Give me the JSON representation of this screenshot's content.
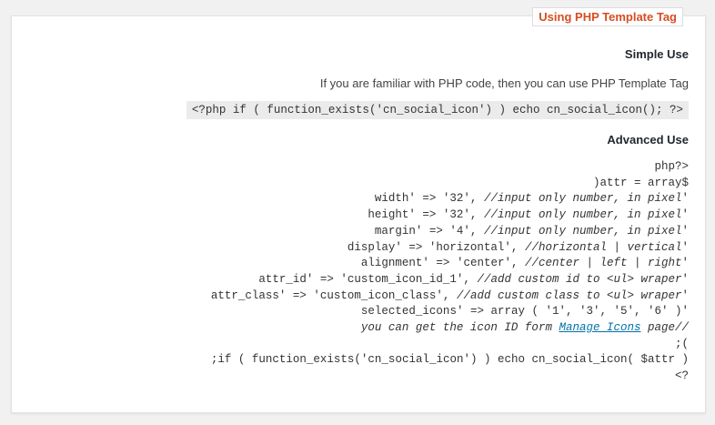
{
  "panel": {
    "title": "Using PHP Template Tag"
  },
  "simple": {
    "heading": "Simple Use",
    "description": "If you are familiar with PHP code, then you can use PHP Template Tag",
    "code": "<?php if ( function_exists('cn_social_icon') ) echo cn_social_icon(); ?>"
  },
  "advanced": {
    "heading": "Advanced Use",
    "lines": [
      {
        "code": "<?php"
      },
      {
        "code": "$attr = array("
      },
      {
        "code": "'width' => '32', ",
        "comment": "//input only number, in pixel"
      },
      {
        "code": "'height' => '32', ",
        "comment": "//input only number, in pixel"
      },
      {
        "code": "'margin' => '4', ",
        "comment": "//input only number, in pixel"
      },
      {
        "code": "'display' => 'horizontal', ",
        "comment": "//horizontal | vertical"
      },
      {
        "code": "'alignment' => 'center', ",
        "comment": "//center | left | right"
      },
      {
        "code": "'attr_id' => 'custom_icon_id_1', ",
        "comment": "//add custom id to <ul> wraper"
      },
      {
        "code": "'attr_class' => 'custom_icon_class', ",
        "comment": "//add custom class to <ul> wraper"
      },
      {
        "code": "'selected_icons' => array ( '1', '3', '5', '6' )"
      },
      {
        "comment_pre": "//you can get the icon ID form ",
        "link": "Manage Icons",
        "comment_post": " page"
      },
      {
        "code": ");"
      },
      {
        "code": "if ( function_exists('cn_social_icon') ) echo cn_social_icon( $attr );"
      },
      {
        "code": "?>"
      }
    ]
  }
}
